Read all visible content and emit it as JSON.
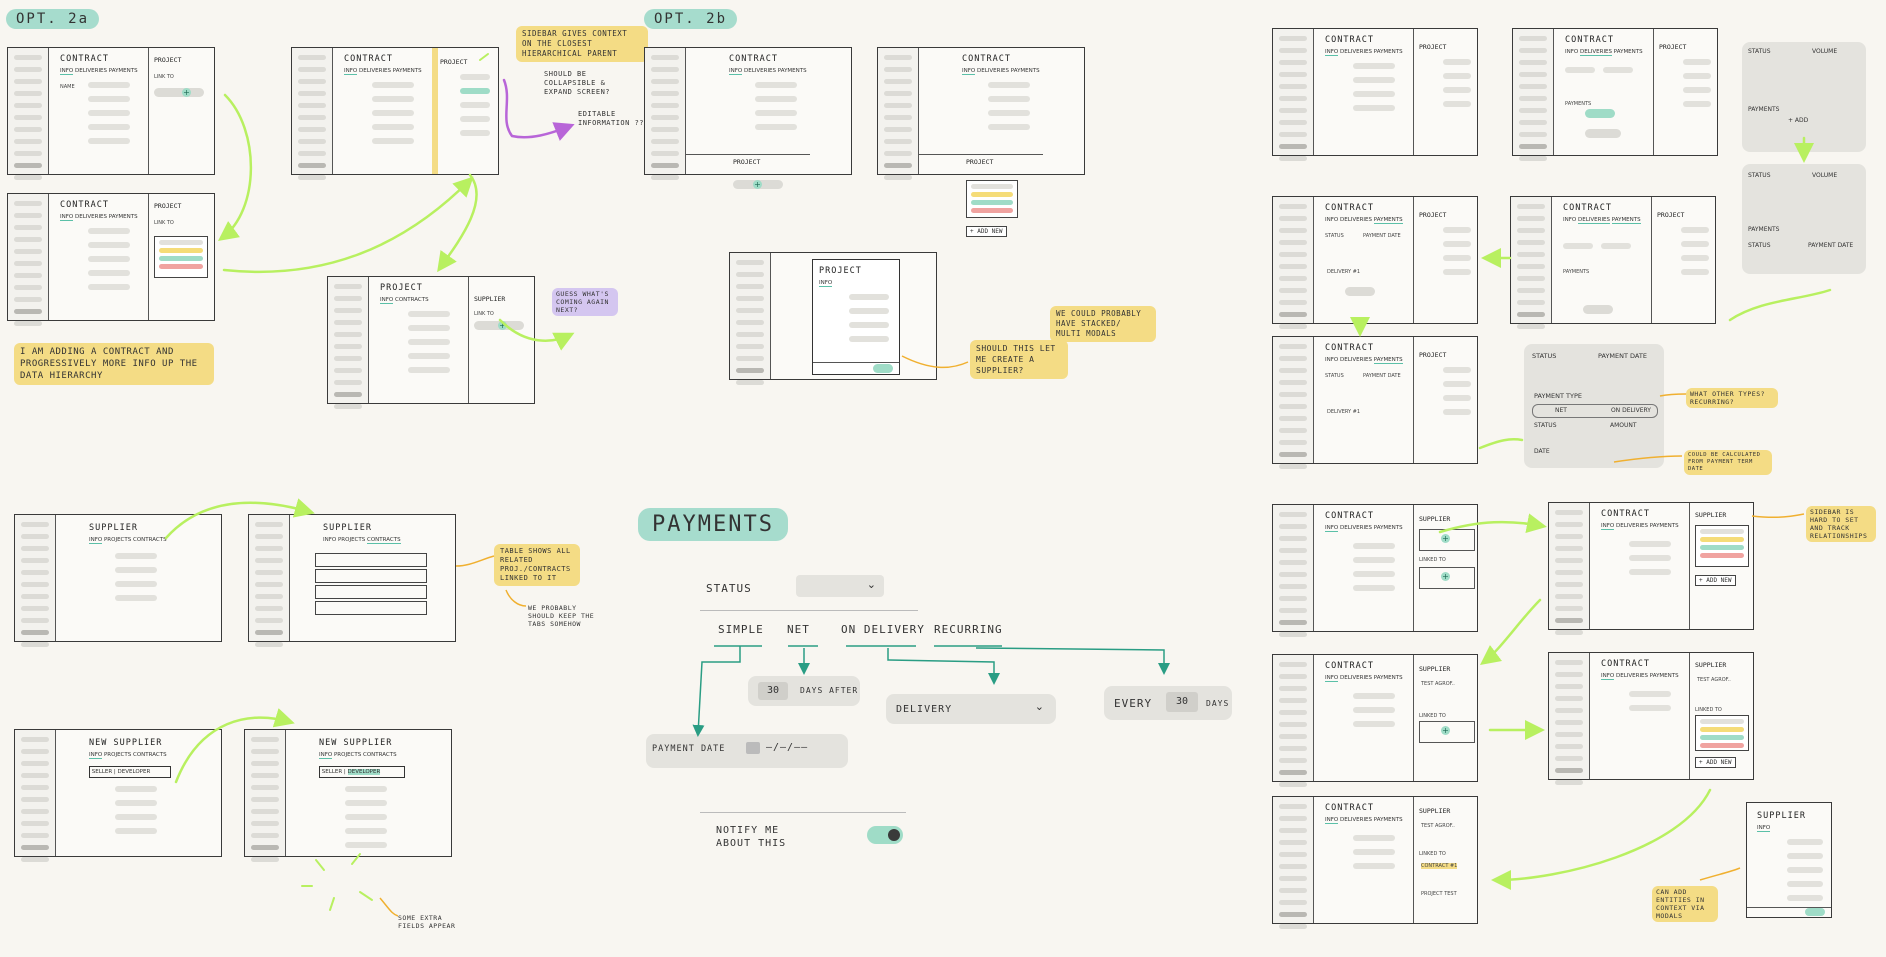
{
  "sections": {
    "opt2a": "OPT. 2a",
    "opt2b": "OPT. 2b",
    "payments": "PAYMENTS"
  },
  "wireframe": {
    "contract": "CONTRACT",
    "project": "PROJECT",
    "supplier": "SUPPLIER",
    "new_supplier": "NEW SUPPLIER",
    "tabs_contract": [
      "INFO",
      "DELIVERIES",
      "PAYMENTS"
    ],
    "tabs_supplier": [
      "INFO",
      "PROJECTS",
      "CONTRACTS"
    ],
    "tabs_project": [
      "INFO",
      "CONTRACTS"
    ],
    "link_to": "LINK TO",
    "add_new": "+ ADD NEW",
    "linked_to": "LINKED TO",
    "seller": "SELLER",
    "developer": "DEVELOPER",
    "status": "STATUS",
    "payment_date": "PAYMENT DATE",
    "volume": "VOLUME",
    "payments": "PAYMENTS",
    "add": "+ ADD",
    "delivery_1": "DELIVERY #1",
    "payment_type": "PAYMENT TYPE",
    "net": "NET",
    "on_delivery": "ON DELIVERY",
    "amount": "AMOUNT",
    "date": "DATE",
    "test_agro": "TEST AGROF..",
    "contract_1": "CONTRACT #1",
    "project_test": "PROJECT TEST",
    "name": "NAME"
  },
  "notes": {
    "sidebar_context": "SIDEBAR GIVES CONTEXT ON THE CLOSEST HIERARCHICAL PARENT",
    "collapsible": "SHOULD BE COLLAPSIBLE & EXPAND SCREEN?",
    "editable": "EDITABLE INFORMATION ??",
    "adding_contract": "I AM ADDING A CONTRACT AND PROGRESSIVELY MORE INFO UP THE DATA HIERARCHY",
    "guess_whats_coming": "GUESS WHAT'S COMING AGAIN NEXT?",
    "should_this": "SHOULD THIS LET ME CREATE A SUPPLIER?",
    "stacked_modals": "WE COULD PROBABLY HAVE STACKED/ MULTI MODALS",
    "table_shows": "TABLE SHOWS ALL RELATED PROJ./CONTRACTS LINKED TO IT",
    "keep_tabs": "WE PROBABLY SHOULD KEEP THE TABS SOMEHOW",
    "extra_fields": "SOME EXTRA FIELDS APPEAR",
    "other_types": "WHAT OTHER TYPES? RECURRING?",
    "calculated": "COULD BE CALCULATED FROM PAYMENT TERM DATE",
    "sidebar_hard": "SIDEBAR IS HARD TO SET AND TRACK RELATIONSHIPS",
    "add_entities": "CAN ADD ENTITIES IN CONTEXT VIA MODALS"
  },
  "payments": {
    "status_label": "STATUS",
    "options": [
      "SIMPLE",
      "NET",
      "ON DELIVERY",
      "RECURRING"
    ],
    "days_value": "30",
    "days_after": "DAYS AFTER",
    "delivery_label": "DELIVERY",
    "every_label": "EVERY",
    "every_value": "30",
    "every_unit": "DAYS",
    "payment_date_label": "PAYMENT DATE",
    "date_value": "—/—/——",
    "notify": "NOTIFY ME ABOUT THIS"
  },
  "colors": {
    "background": "#f8f6f1",
    "note_yellow": "#f4dc85",
    "teal": "#5bc0a8",
    "heading_teal": "#a6dccd",
    "arrow_green": "#b8f060",
    "arrow_purple": "#b865d8",
    "arrow_orange": "#f0b030",
    "teal_line": "#2a9d84"
  }
}
